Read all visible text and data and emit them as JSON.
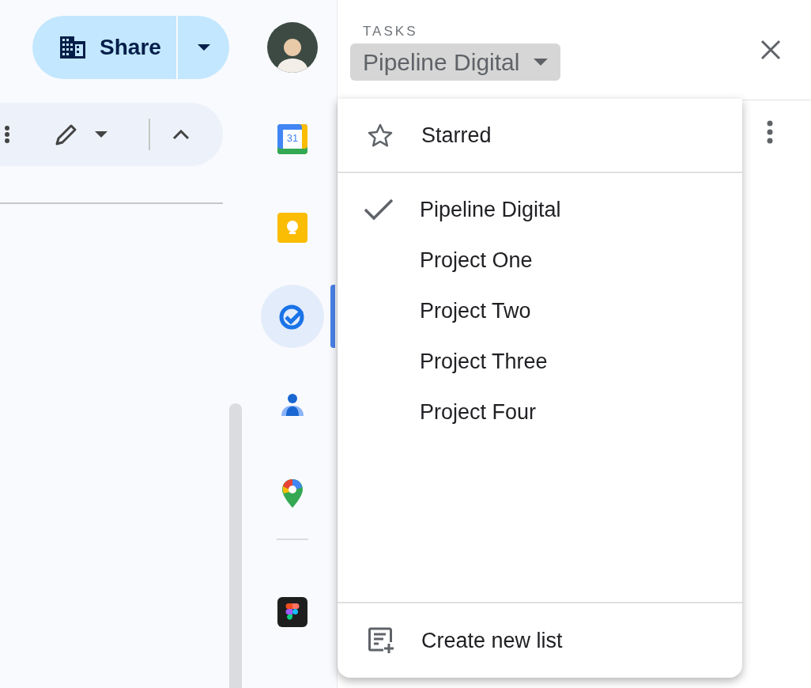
{
  "header": {
    "share_button": {
      "label": "Share"
    }
  },
  "side_rail": {
    "apps": [
      {
        "kind": "calendar",
        "label": "31",
        "selected": false
      },
      {
        "kind": "keep",
        "selected": false
      },
      {
        "kind": "tasks",
        "selected": true
      },
      {
        "kind": "contacts",
        "selected": false
      },
      {
        "kind": "maps",
        "selected": false
      }
    ],
    "more_apps": [
      {
        "kind": "figma",
        "selected": false
      }
    ]
  },
  "tasks_panel": {
    "app_label": "TASKS",
    "list_selector": "Pipeline Digital",
    "menu": {
      "starred": "Starred",
      "lists": [
        {
          "label": "Pipeline Digital",
          "selected": true
        },
        {
          "label": "Project One",
          "selected": false
        },
        {
          "label": "Project Two",
          "selected": false
        },
        {
          "label": "Project Three",
          "selected": false
        },
        {
          "label": "Project Four",
          "selected": false
        }
      ],
      "create": "Create new list"
    }
  }
}
